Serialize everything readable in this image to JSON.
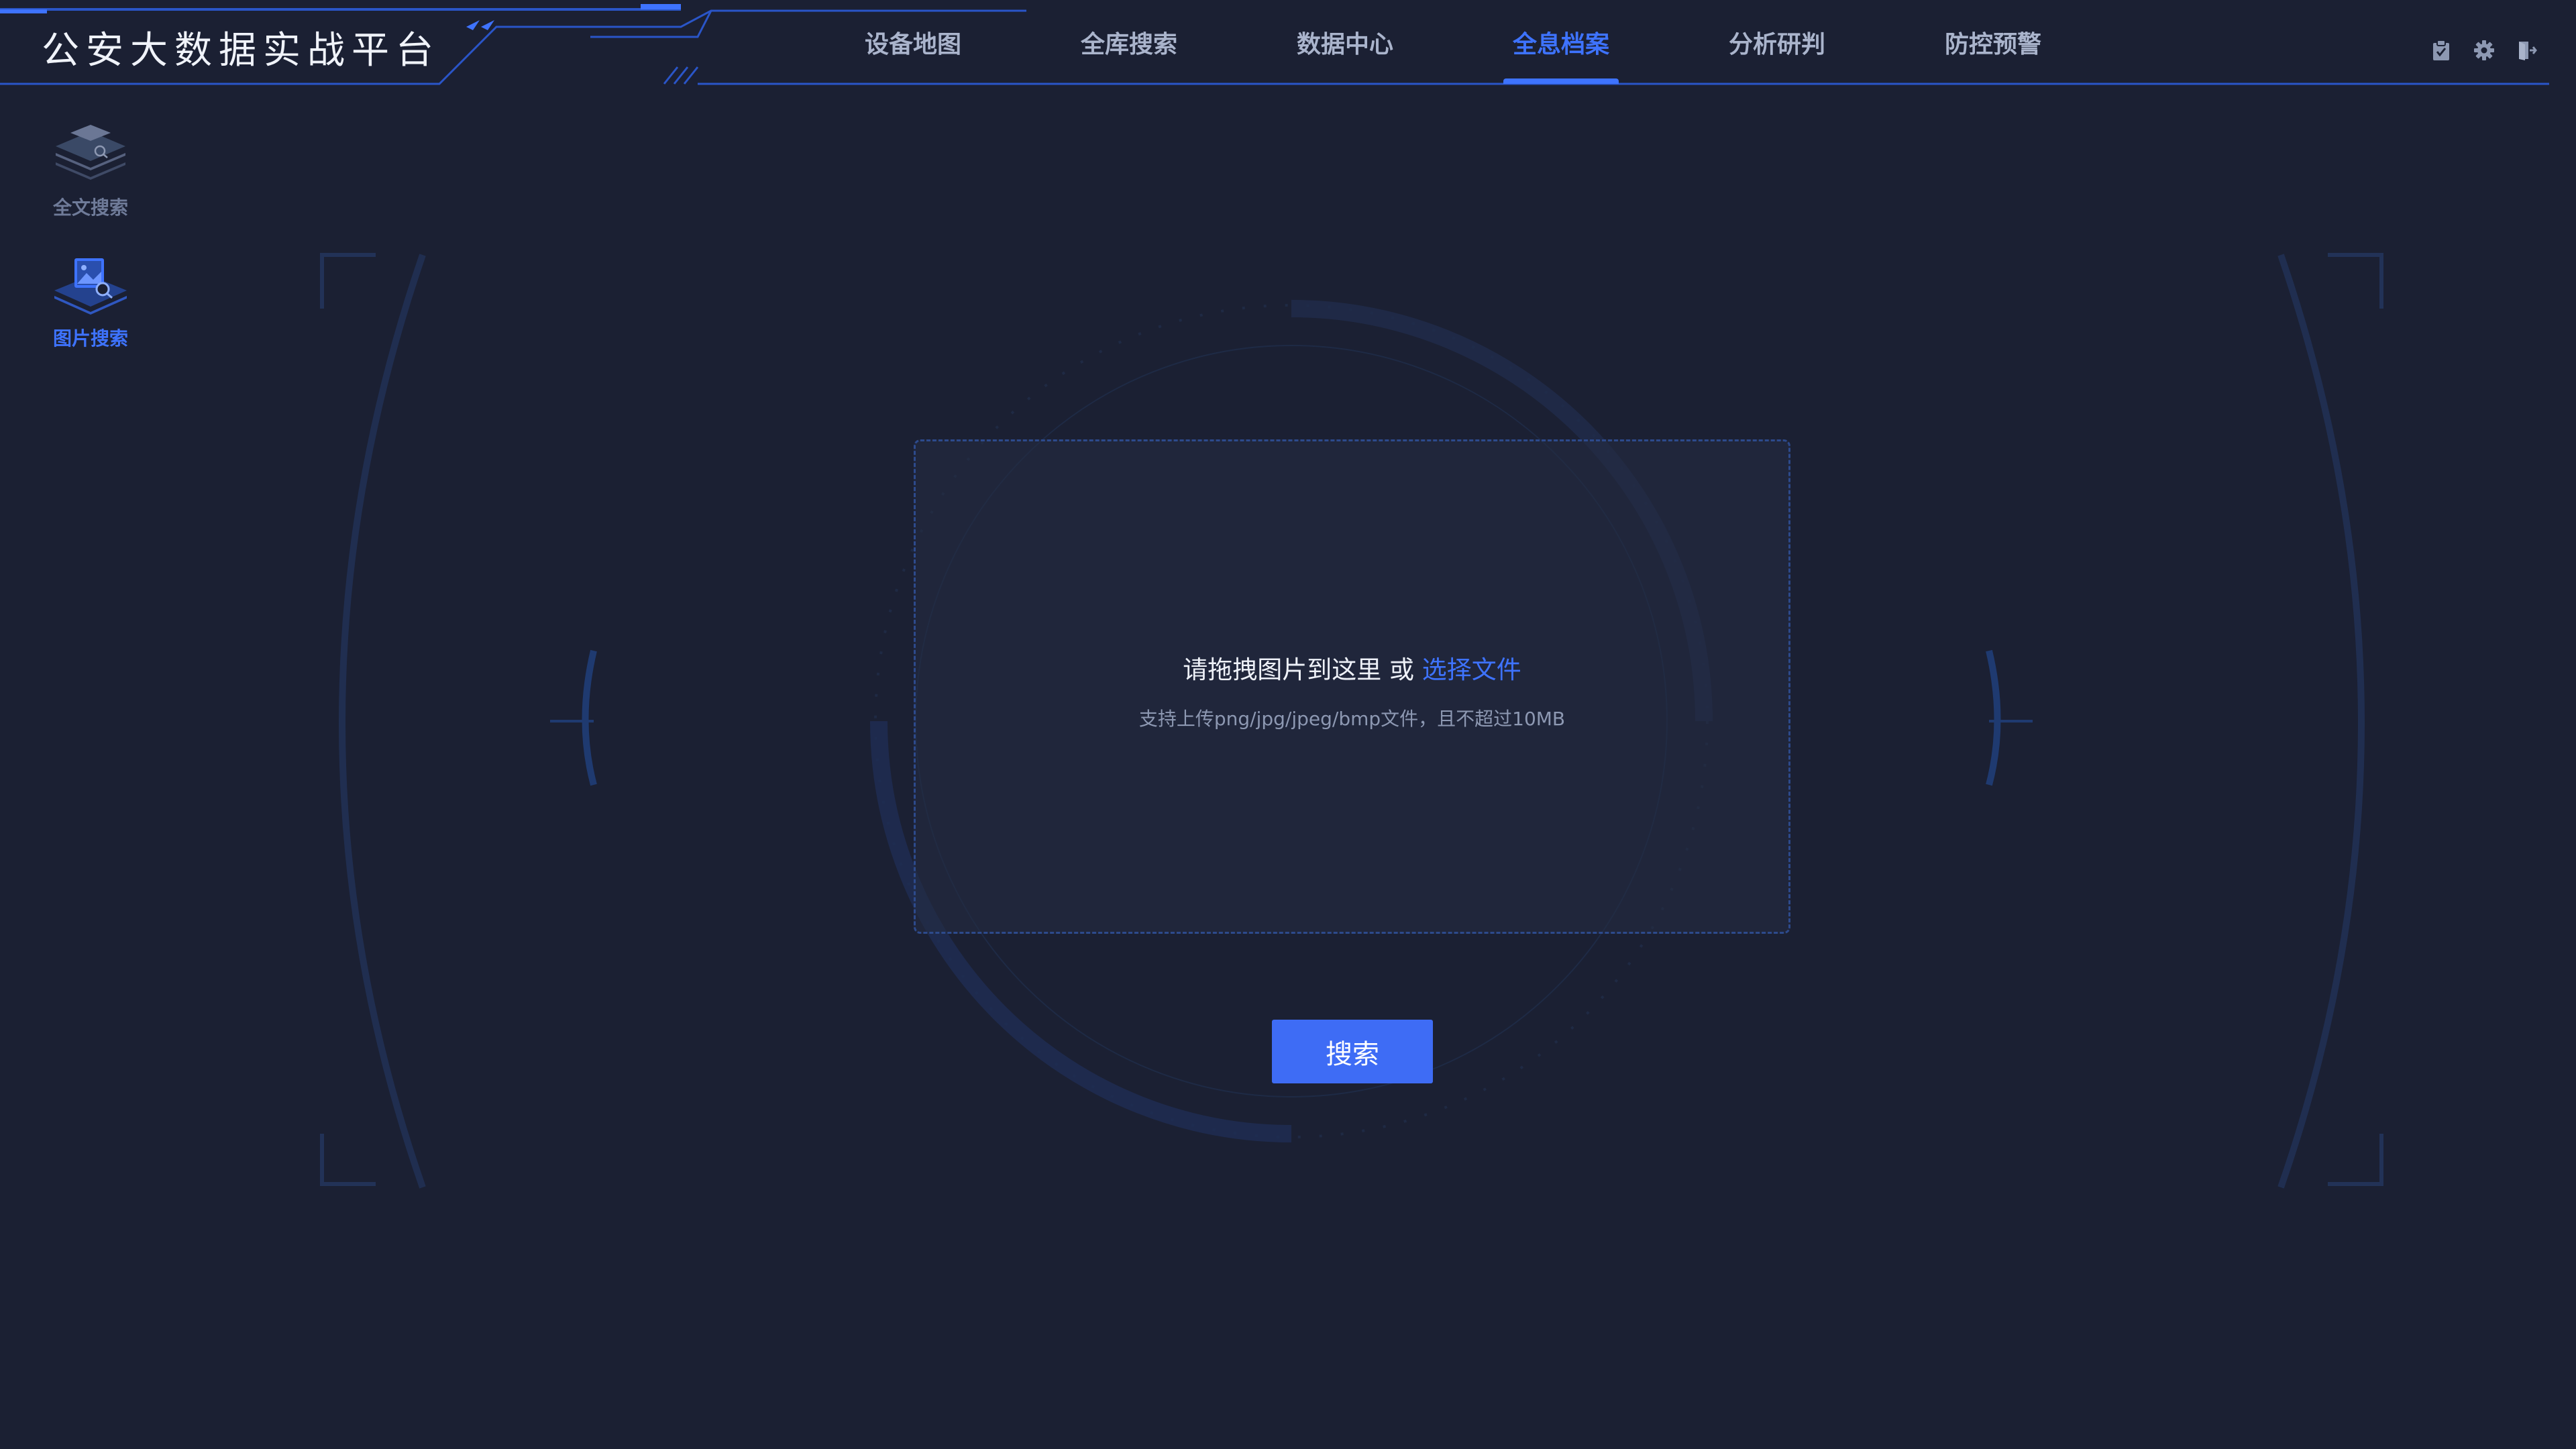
{
  "header": {
    "app_title": "公安大数据实战平台",
    "nav": [
      {
        "label": "设备地图",
        "active": false
      },
      {
        "label": "全库搜索",
        "active": false
      },
      {
        "label": "数据中心",
        "active": false
      },
      {
        "label": "全息档案",
        "active": true
      },
      {
        "label": "分析研判",
        "active": false
      },
      {
        "label": "防控预警",
        "active": false
      }
    ],
    "tools": [
      "clipboard-icon",
      "gear-icon",
      "logout-icon"
    ]
  },
  "sidebar": {
    "items": [
      {
        "label": "全文搜索",
        "icon": "layers-search-icon",
        "active": false
      },
      {
        "label": "图片搜索",
        "icon": "image-search-icon",
        "active": true
      }
    ]
  },
  "upload": {
    "prompt": "请拖拽图片到这里 或",
    "link_label": "选择文件",
    "hint": "支持上传png/jpg/jpeg/bmp文件，且不超过10MB"
  },
  "search_button": {
    "label": "搜索"
  },
  "colors": {
    "background": "#1b2033",
    "accent": "#3e73ff",
    "nav_text": "#aab4cc",
    "muted_text": "#6f7b99"
  }
}
